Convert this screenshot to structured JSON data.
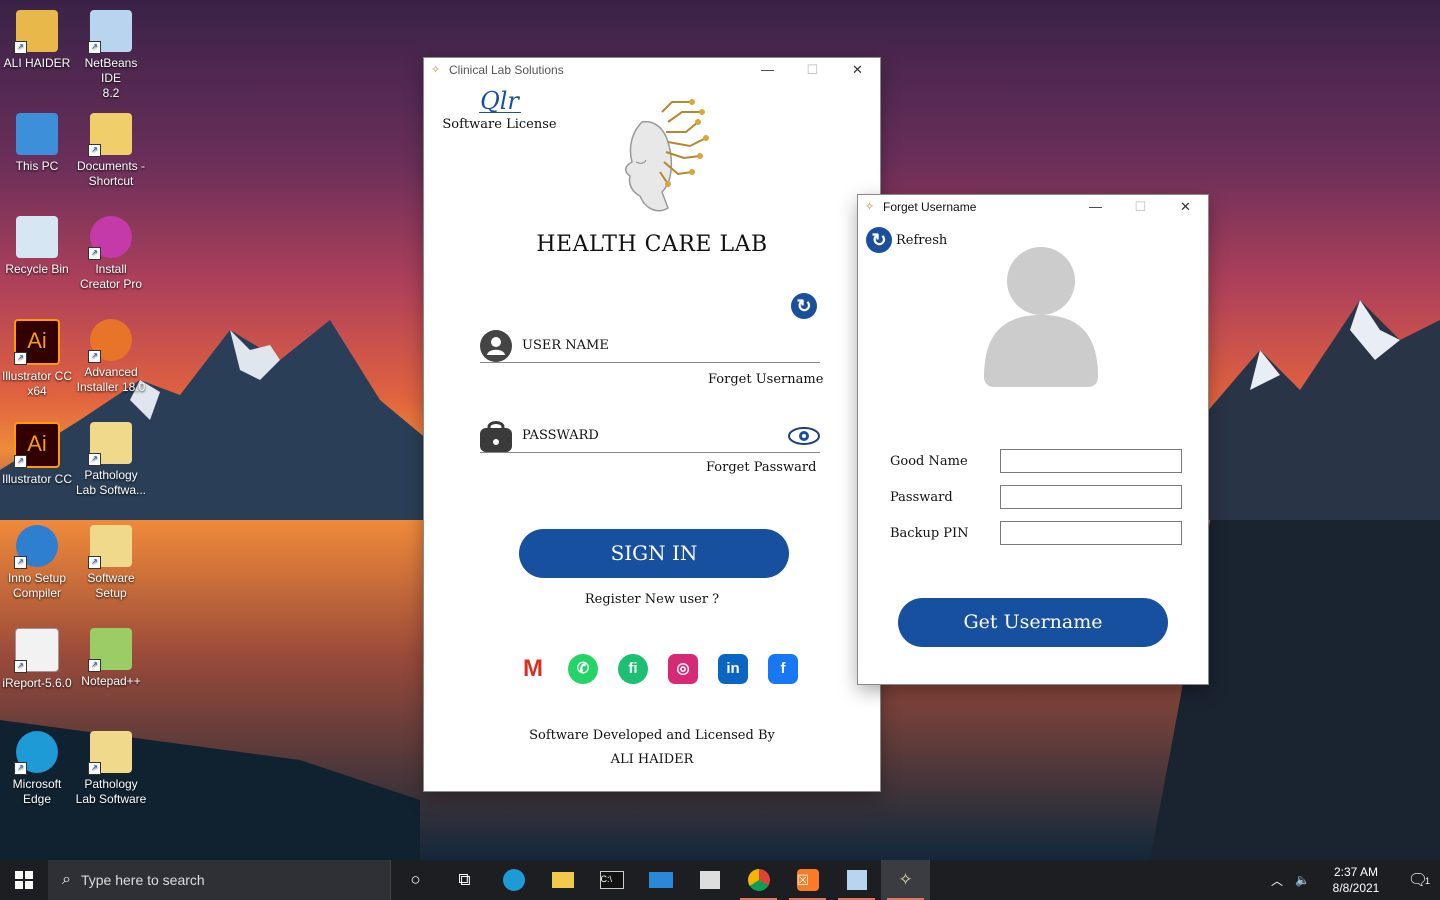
{
  "desktop": {
    "icons": [
      {
        "label_1": "ALI HAIDER",
        "label_2": ""
      },
      {
        "label_1": "NetBeans IDE",
        "label_2": "8.2"
      },
      {
        "label_1": "This PC",
        "label_2": ""
      },
      {
        "label_1": "Documents -",
        "label_2": "Shortcut"
      },
      {
        "label_1": "Recycle Bin",
        "label_2": ""
      },
      {
        "label_1": "Install",
        "label_2": "Creator Pro"
      },
      {
        "label_1": "Illustrator CC",
        "label_2": "x64"
      },
      {
        "label_1": "Advanced",
        "label_2": "Installer 18.0"
      },
      {
        "label_1": "Illustrator CC",
        "label_2": ""
      },
      {
        "label_1": "Pathology",
        "label_2": "Lab Softwa..."
      },
      {
        "label_1": "Inno Setup",
        "label_2": "Compiler"
      },
      {
        "label_1": "Software",
        "label_2": "Setup"
      },
      {
        "label_1": "iReport-5.6.0",
        "label_2": ""
      },
      {
        "label_1": "Notepad++",
        "label_2": ""
      },
      {
        "label_1": "Microsoft",
        "label_2": "Edge"
      },
      {
        "label_1": "Pathology",
        "label_2": "Lab Software"
      }
    ]
  },
  "main_window": {
    "title": "Clinical Lab Solutions",
    "license_label": "Software License",
    "signature_text": "Qlr",
    "app_title": "HEALTH CARE LAB",
    "username_label": "USER NAME",
    "forget_username": "Forget Username",
    "password_label": "PASSWARD",
    "forget_password": "Forget Passward",
    "signin_label": "SIGN IN",
    "register_label": "Register New user ?",
    "footer_line1": "Software Developed and Licensed By",
    "footer_line2": "ALI HAIDER",
    "brand_color": "#16509e"
  },
  "forget_window": {
    "title": "Forget Username",
    "refresh_label": "Refresh",
    "fields": [
      {
        "label": "Good Name",
        "value": ""
      },
      {
        "label": "Passward",
        "value": ""
      },
      {
        "label": "Backup PIN",
        "value": ""
      }
    ],
    "button_label": "Get Username"
  },
  "taskbar": {
    "search_placeholder": "Type here to search",
    "time": "2:37 AM",
    "date": "8/8/2021",
    "notification_count": "1"
  }
}
